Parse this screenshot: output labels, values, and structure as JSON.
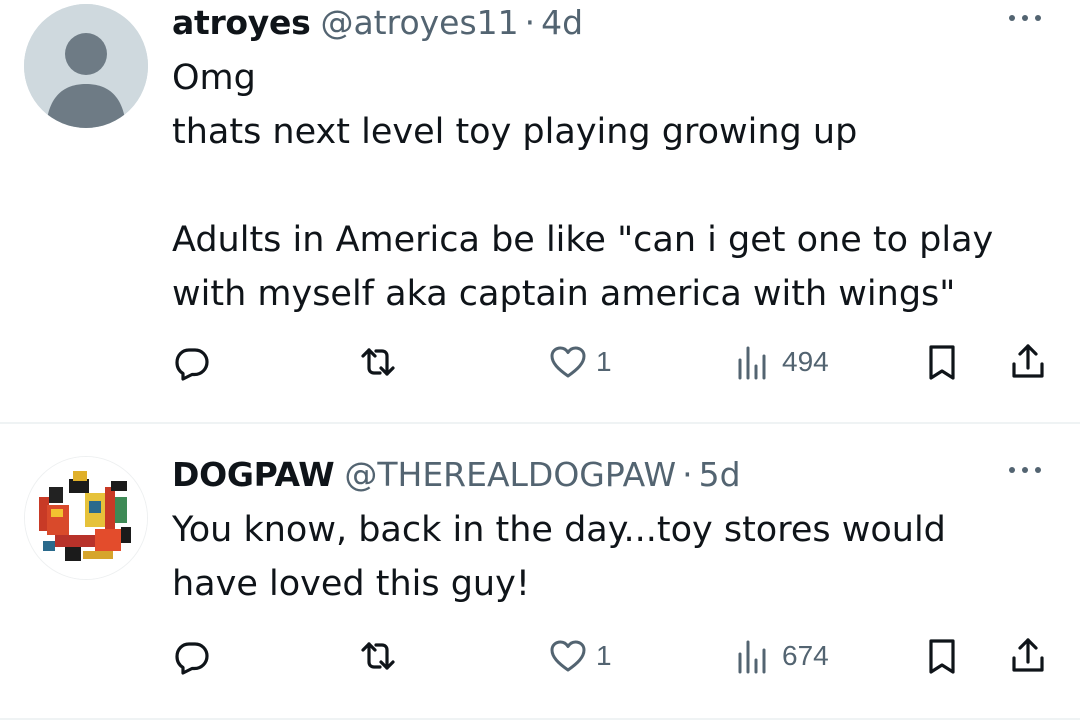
{
  "tweets": [
    {
      "author_name": "atroyes",
      "author_handle": "@atroyes11",
      "separator": "·",
      "time": "4d",
      "avatar": "default-avatar-icon",
      "lines": [
        "Omg",
        "thats next level toy playing growing up",
        "",
        "Adults in America be like \"can i get one to play",
        "with myself aka captain america with wings\""
      ],
      "likes": "1",
      "views": "494"
    },
    {
      "author_name": "DOGPAW",
      "author_handle": "@THEREALDOGPAW",
      "separator": "·",
      "time": "5d",
      "avatar": "illustrated-avatar",
      "lines": [
        "You know, back in the day...toy stores would",
        "have loved this guy!"
      ],
      "likes": "1",
      "views": "674"
    }
  ],
  "icons": {
    "reply": "reply-icon",
    "retweet": "retweet-icon",
    "like": "heart-icon",
    "views": "views-chart-icon",
    "bookmark": "bookmark-icon",
    "share": "share-icon",
    "more": "more-dots-icon"
  },
  "colors": {
    "text": "#0f1419",
    "secondary": "#536471",
    "divider": "#eff3f4",
    "avatar_default": "#cfd9de"
  }
}
